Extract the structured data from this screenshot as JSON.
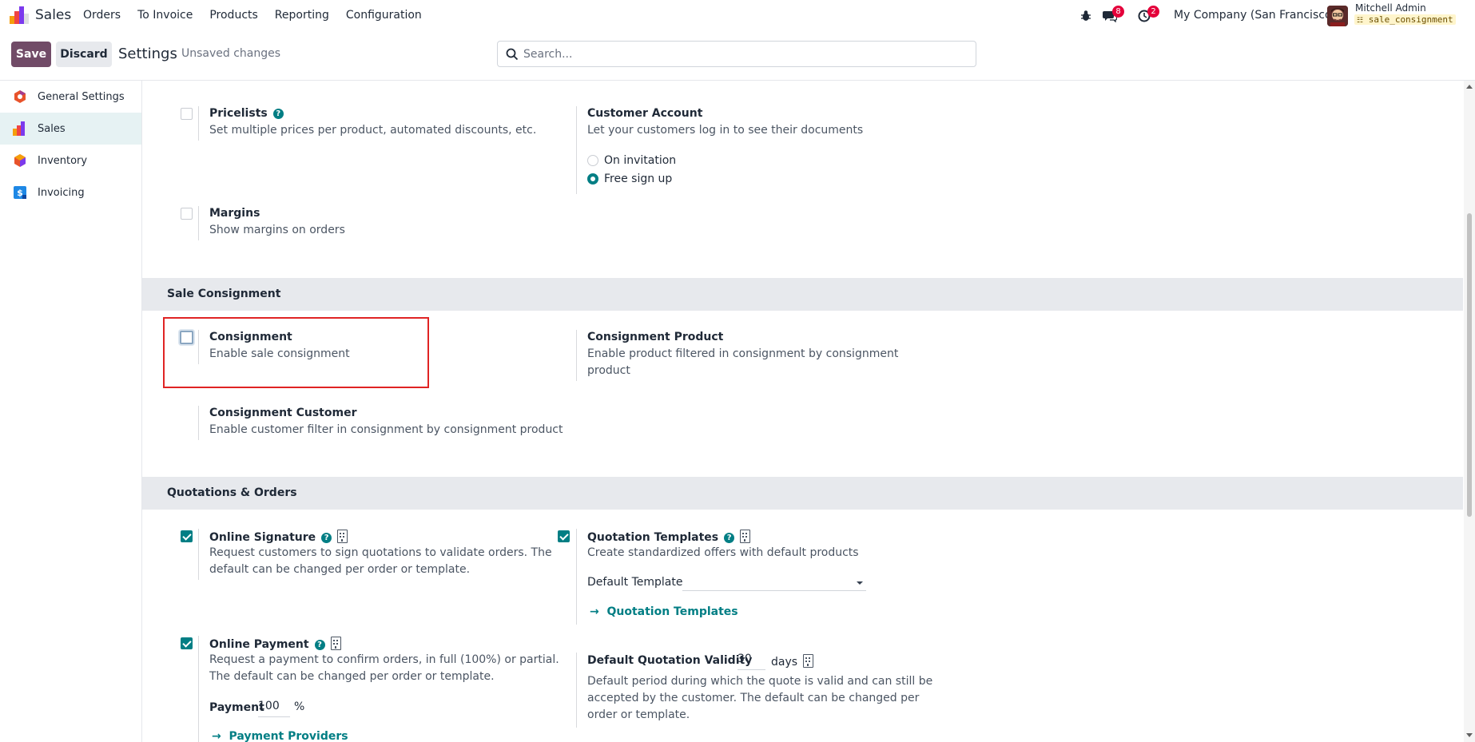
{
  "navbar": {
    "app_name": "Sales",
    "menu": [
      "Orders",
      "To Invoice",
      "Products",
      "Reporting",
      "Configuration"
    ],
    "messages_count": "8",
    "activities_count": "2",
    "company": "My Company (San Francisco)",
    "user_name": "Mitchell Admin",
    "database": "sale_consignment"
  },
  "control_panel": {
    "save_label": "Save",
    "discard_label": "Discard",
    "breadcrumb": "Settings",
    "status": "Unsaved changes",
    "search_placeholder": "Search..."
  },
  "sidebar": {
    "items": [
      {
        "label": "General Settings",
        "icon": "general-settings-icon",
        "active": false
      },
      {
        "label": "Sales",
        "icon": "sales-app-icon",
        "active": true
      },
      {
        "label": "Inventory",
        "icon": "inventory-app-icon",
        "active": false
      },
      {
        "label": "Invoicing",
        "icon": "invoicing-app-icon",
        "active": false
      }
    ]
  },
  "pricing": {
    "pricelists": {
      "title": "Pricelists",
      "desc": "Set multiple prices per product, automated discounts, etc.",
      "checked": false
    },
    "customer_account": {
      "title": "Customer Account",
      "desc": "Let your customers log in to see their documents",
      "options": [
        "On invitation",
        "Free sign up"
      ],
      "selected": "Free sign up"
    },
    "margins": {
      "title": "Margins",
      "desc": "Show margins on orders",
      "checked": false
    }
  },
  "sale_consignment": {
    "section_title": "Sale Consignment",
    "consignment": {
      "title": "Consignment",
      "desc": "Enable sale consignment",
      "checked": false
    },
    "consignment_product": {
      "title": "Consignment Product",
      "desc_line1": "Enable product filtered in consignment by consignment",
      "desc_line2": "product"
    },
    "consignment_customer": {
      "title": "Consignment Customer",
      "desc": "Enable customer filter in consignment by consignment product"
    }
  },
  "quotations": {
    "section_title": "Quotations & Orders",
    "online_signature": {
      "title": "Online Signature",
      "desc_line1": "Request customers to sign quotations to validate orders. The",
      "desc_line2": "default can be changed per order or template.",
      "checked": true
    },
    "quotation_templates": {
      "title": "Quotation Templates",
      "desc": "Create standardized offers with default products",
      "checked": true,
      "default_template_label": "Default Template",
      "default_template_value": "",
      "link": "Quotation Templates"
    },
    "online_payment": {
      "title": "Online Payment",
      "desc_line1": "Request a payment to confirm orders, in full (100%) or partial.",
      "desc_line2": "The default can be changed per order or template.",
      "checked": true,
      "payment_label": "Payment",
      "payment_value": "100",
      "payment_unit": "%",
      "link": "Payment Providers"
    },
    "validity": {
      "title": "Default Quotation Validity",
      "value": "30",
      "unit": "days",
      "desc_line1": "Default period during which the quote is valid and can still be",
      "desc_line2": "accepted by the customer. The default can be changed per",
      "desc_line3": "order or template."
    }
  },
  "colors": {
    "brand": "#714b67",
    "accent": "#017e84",
    "highlight": "#e02424",
    "badge": "#e4003a"
  }
}
